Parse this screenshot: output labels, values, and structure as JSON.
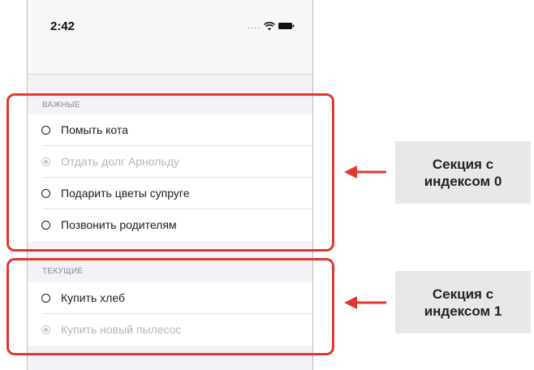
{
  "status_bar": {
    "time": "2:42",
    "signal": "....",
    "icons": [
      "wifi-icon",
      "battery-icon"
    ]
  },
  "sections": [
    {
      "header": "ВАЖНЫЕ",
      "items": [
        {
          "label": "Помыть кота",
          "completed": false
        },
        {
          "label": "Отдать долг Арнольду",
          "completed": true
        },
        {
          "label": "Подарить цветы супруге",
          "completed": false
        },
        {
          "label": "Позвонить родителям",
          "completed": false
        }
      ]
    },
    {
      "header": "ТЕКУЩИЕ",
      "items": [
        {
          "label": "Купить хлеб",
          "completed": false
        },
        {
          "label": "Купить новый пылесос",
          "completed": true
        }
      ]
    }
  ],
  "callouts": [
    {
      "line1": "Секция с",
      "line2": "индексом 0"
    },
    {
      "line1": "Секция с",
      "line2": "индексом 1"
    }
  ],
  "colors": {
    "highlight": "#e2372e",
    "callout_bg": "#e8e8e8",
    "grouped_bg": "#f2f2f7"
  }
}
